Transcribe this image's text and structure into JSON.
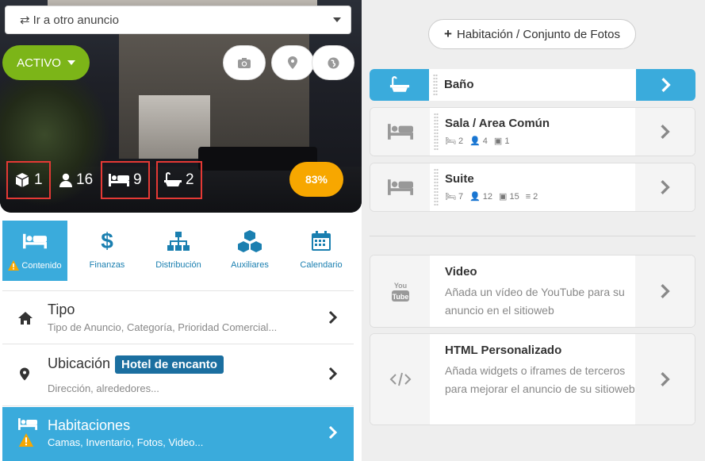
{
  "ad_selector": {
    "label": "Ir a otro anuncio"
  },
  "status": {
    "label": "ACTIVO",
    "color": "#7cb518"
  },
  "stats": {
    "units": "1",
    "guests": "16",
    "beds": "9",
    "baths": "2"
  },
  "completion": "83%",
  "tabs": [
    {
      "label": "Contenido",
      "icon": "bed-icon",
      "active": true,
      "warning": true
    },
    {
      "label": "Finanzas",
      "icon": "dollar-icon"
    },
    {
      "label": "Distribución",
      "icon": "sitemap-icon"
    },
    {
      "label": "Auxiliares",
      "icon": "cubes-icon"
    },
    {
      "label": "Calendario",
      "icon": "calendar-icon"
    }
  ],
  "menu": {
    "tipo": {
      "title": "Tipo",
      "subtitle": "Tipo de Anuncio, Categoría, Prioridad Comercial..."
    },
    "ubicacion": {
      "title": "Ubicación",
      "tag": "Hotel de encanto",
      "subtitle": "Dirección, alrededores..."
    },
    "habitaciones": {
      "title": "Habitaciones",
      "subtitle": "Camas, Inventario, Fotos, Video..."
    }
  },
  "right": {
    "add_button": "Habitación / Conjunto de Fotos",
    "rooms": [
      {
        "name": "Baño",
        "icon": "bath-icon",
        "active": true
      },
      {
        "name": "Sala / Area Común",
        "icon": "bed-icon",
        "beds": "2",
        "guests": "4",
        "photos": "1"
      },
      {
        "name": "Suite",
        "icon": "bed-icon",
        "beds": "7",
        "guests": "12",
        "photos": "15",
        "items": "2"
      }
    ],
    "video": {
      "title": "Video",
      "desc": "Añada un vídeo de YouTube para su anuncio en el sitioweb"
    },
    "html": {
      "title": "HTML Personalizado",
      "desc": "Añada widgets o iframes de terceros para mejorar el anuncio de su sitioweb"
    }
  },
  "colors": {
    "accent": "#3aabdc",
    "active_green": "#7cb518",
    "badge_orange": "#f7a700",
    "tag_blue": "#1b6fa0",
    "highlight_red": "#e53935"
  }
}
